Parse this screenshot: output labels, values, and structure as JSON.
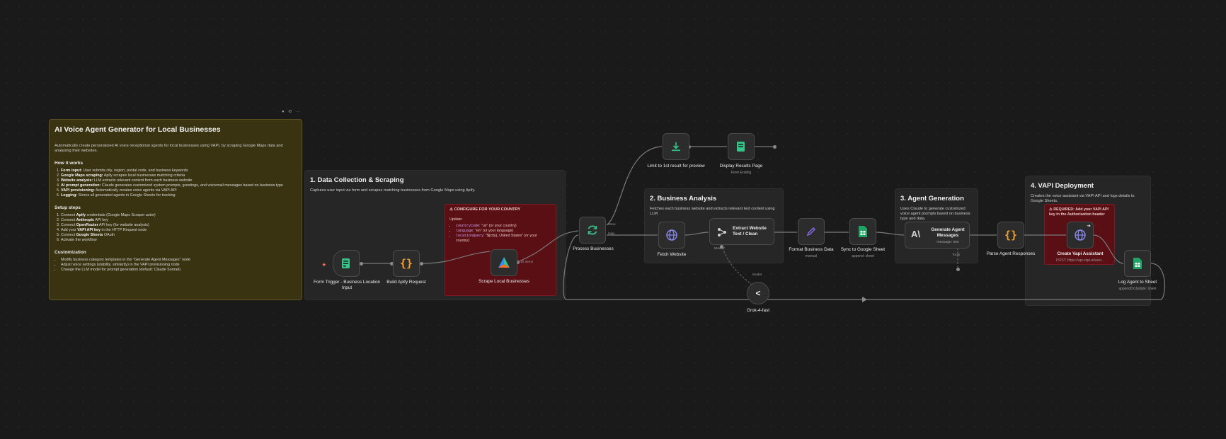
{
  "toolbar": {
    "a": "●",
    "b": "⊘",
    "c": "···"
  },
  "main_note": {
    "title": "AI Voice Agent Generator for Local Businesses",
    "intro": "Automatically create personalized AI voice receptionist agents for local businesses using VAPI, by scraping Google Maps data and analysing their websites.",
    "how_title": "How it works",
    "how": [
      {
        "b": "Form input:",
        "t": " User submits city, region, postal code, and business keywords"
      },
      {
        "b": "Google Maps scraping:",
        "t": " Apify scrapes local businesses matching criteria"
      },
      {
        "b": "Website analysis:",
        "t": " LLM extracts relevant content from each business website"
      },
      {
        "b": "AI prompt generation:",
        "t": " Claude generates customized system prompts, greetings, and voicemail messages based on business type"
      },
      {
        "b": "VAPI provisioning:",
        "t": " Automatically creates voice agents via VAPI API"
      },
      {
        "b": "Logging:",
        "t": " Stores all generated agents in Google Sheets for tracking"
      }
    ],
    "setup_title": "Setup steps",
    "setup": [
      {
        "t1": "Connect ",
        "b": "Apify",
        "t2": " credentials (Google Maps Scraper actor)"
      },
      {
        "t1": "Connect ",
        "b": "Anthropic",
        "t2": " API key"
      },
      {
        "t1": "Connect ",
        "b": "OpenRouter",
        "t2": " API key (for website analysis)"
      },
      {
        "t1": "Add your ",
        "b": "VAPI API key",
        "t2": " in the HTTP Request node"
      },
      {
        "t1": "Connect ",
        "b": "Google Sheets",
        "t2": " OAuth"
      },
      {
        "t1": "Activate the workflow",
        "b": "",
        "t2": ""
      }
    ],
    "custom_title": "Customization",
    "custom": [
      "Modify business category templates in the \"Generate Agent Messages\" node",
      "Adjust voice settings (stability, similarity) in the VAPI provisioning node",
      "Change the LLM model for prompt generation (default: Claude Sonnet)"
    ]
  },
  "sections": {
    "s1": {
      "title": "1. Data Collection & Scraping",
      "desc": "Captures user input via form and scrapes matching businesses from Google Maps using Apify."
    },
    "s2": {
      "title": "2. Business Analysis",
      "desc": "Fetches each business website and extracts relevant text content using LLM."
    },
    "s3": {
      "title": "3. Agent Generation",
      "desc": "Uses Claude to generate customized voice agent prompts based on business type and data."
    },
    "s4": {
      "title": "4. VAPI Deployment",
      "desc": "Creates the voice assistant via VAPI API and logs details to Google Sheets."
    }
  },
  "warn_country": {
    "title": "⚠ CONFIGURE FOR YOUR COUNTRY",
    "update": "Update:",
    "items": [
      {
        "k": "countryCode",
        "v": ": \"us\" (or your country)"
      },
      {
        "k": "language",
        "v": ": \"en\" (or your language)"
      },
      {
        "k": "locationQuery",
        "v": ": \"${city}, United States\" (or your country)"
      }
    ]
  },
  "warn_vapi": {
    "text": "⚠ REQUIRED: Add your VAPI API key in the Authorization header"
  },
  "nodes": {
    "form_trigger": {
      "label": "Form Trigger - Business Location Input"
    },
    "build_apify": {
      "label": "Build Apify Request"
    },
    "scrape": {
      "label": "Scrape Local Businesses",
      "items": "10 items"
    },
    "process": {
      "label": "Process Businesses",
      "done": "done",
      "loop": "loop"
    },
    "limit": {
      "label": "Limit to 1st result for preview"
    },
    "display": {
      "label": "Display Results Page",
      "sub": "Form Ending"
    },
    "fetch": {
      "label": "Fetch Website"
    },
    "extract": {
      "label": "Extract Website Text / Clean",
      "model": "Model*"
    },
    "format": {
      "label": "Format Business Data",
      "sub": "manual"
    },
    "sync": {
      "label": "Sync to Google Sheet",
      "sub": "append: sheet"
    },
    "generate": {
      "label": "Generate Agent Messages",
      "sub": "message: text",
      "tools": "Tools"
    },
    "parse": {
      "label": "Parse Agent Responses"
    },
    "create_vapi": {
      "label": "Create Vapi Assistant",
      "sub": "POST: https://api.vapi.ai/assi..."
    },
    "log": {
      "label": "Log Agent to Sheet",
      "sub": "appendOrUpdate: sheet"
    },
    "grok": {
      "label": "Grok-4-fast",
      "model": "Model"
    }
  },
  "colors": {
    "accent_orange": "#ff6d5a",
    "accent_teal": "#35c48a",
    "accent_purple": "#8a6cf0",
    "accent_blue": "#6c8ef0"
  }
}
